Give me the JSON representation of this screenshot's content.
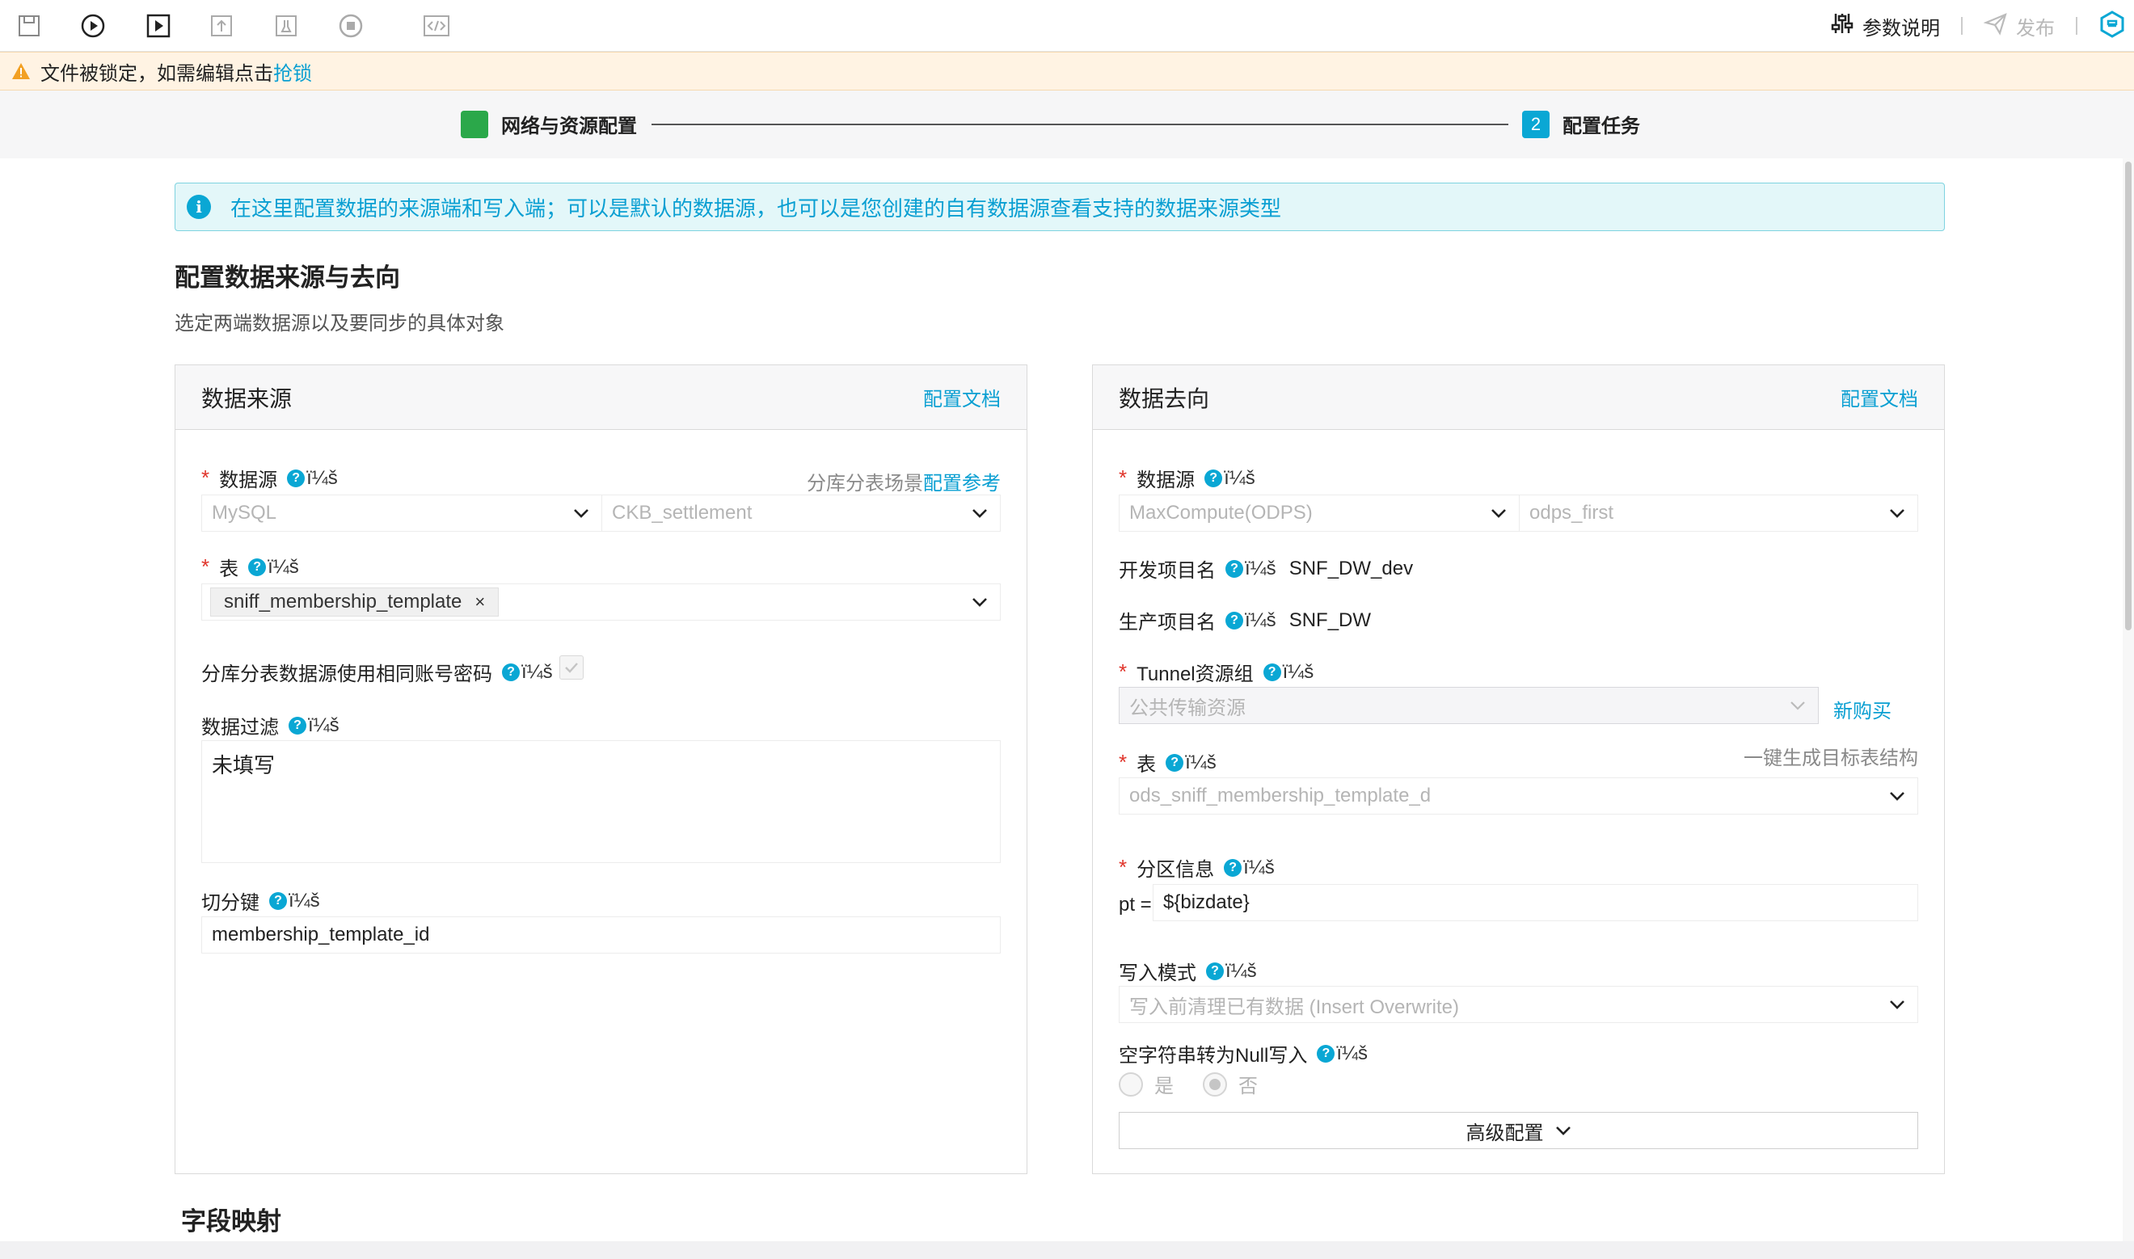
{
  "toolbar": {
    "params_label": "参数说明",
    "publish_label": "发布"
  },
  "lockbar": {
    "message": "文件被锁定，如需编辑点击",
    "link": "抢锁"
  },
  "steps": [
    {
      "index": "",
      "label": "网络与资源配置",
      "color": "#2ba84a"
    },
    {
      "index": "2",
      "label": "配置任务",
      "color": "#0aa7d4"
    }
  ],
  "info": {
    "icon": "i",
    "text": "在这里配置数据的来源端和写入端；可以是默认的数据源，也可以是您创建的自有数据源查看支持的数据来源类型"
  },
  "section": {
    "title": "配置数据来源与去向",
    "subtitle": "选定两端数据源以及要同步的具体对象"
  },
  "help_glyph": "?",
  "garbled": "ï¼š",
  "required_mark": "*",
  "source": {
    "title": "数据来源",
    "doc_link": "配置文档",
    "datasource_label": "数据源",
    "sharding_hint": "分库分表场景",
    "sharding_link": "配置参考",
    "datasource_type": "MySQL",
    "datasource_name": "CKB_settlement",
    "table_label": "表",
    "table_tag": "sniff_membership_template",
    "tag_close": "×",
    "same_account_label": "分库分表数据源使用相同账号密码",
    "filter_label": "数据过滤",
    "filter_value": "未填写",
    "split_key_label": "切分键",
    "split_key_value": "membership_template_id"
  },
  "target": {
    "title": "数据去向",
    "doc_link": "配置文档",
    "datasource_label": "数据源",
    "datasource_type": "MaxCompute(ODPS)",
    "datasource_name": "odps_first",
    "dev_project_label": "开发项目名",
    "dev_project_value": "SNF_DW_dev",
    "prod_project_label": "生产项目名",
    "prod_project_value": "SNF_DW",
    "tunnel_label": "Tunnel资源组",
    "tunnel_value": "公共传输资源",
    "new_purchase": "新购买",
    "table_label": "表",
    "generate_link": "一键生成目标表结构",
    "table_value": "ods_sniff_membership_template_d",
    "partition_label": "分区信息",
    "partition_key": "pt =",
    "partition_value": "${bizdate}",
    "write_mode_label": "写入模式",
    "write_mode_value": "写入前清理已有数据 (Insert Overwrite)",
    "null_label": "空字符串转为Null写入",
    "radio_yes": "是",
    "radio_no": "否",
    "advanced_label": "高级配置"
  },
  "mapping_title": "字段映射"
}
